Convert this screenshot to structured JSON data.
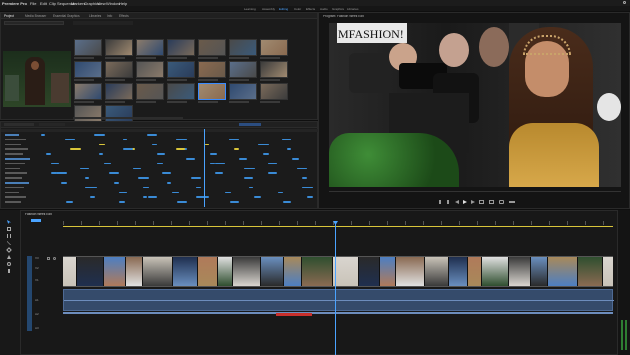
{
  "app": {
    "name": "Premiere Pro"
  },
  "menu": [
    "File",
    "Edit",
    "Clip",
    "Sequence",
    "Markers",
    "Graphics",
    "View",
    "Window",
    "Help"
  ],
  "workspaces": [
    "Learning",
    "Assembly",
    "Editing",
    "Color",
    "Effects",
    "Audio",
    "Graphics",
    "Libraries"
  ],
  "workspace_active": "Editing",
  "project_panel": {
    "tabs": [
      "Project",
      "Media Browser",
      "Essential Graphics",
      "Libraries",
      "Info",
      "Effects"
    ],
    "active_tab": "Project"
  },
  "program_monitor": {
    "title": "Program: Fashion Week Edit",
    "sign_text": "MFASHION!"
  },
  "timeline": {
    "title": "Fashion Week Edit",
    "tracks": [
      "V3",
      "V2",
      "V1",
      "A1",
      "A2",
      "A3"
    ]
  },
  "colors": {
    "accent": "#3a8bff",
    "keyframe": "#3a8bd6",
    "marker_yellow": "#d9c53a",
    "audio_clip": "#354b6b",
    "playhead": "#4aa3ff",
    "render_bar": "#c9302c"
  }
}
